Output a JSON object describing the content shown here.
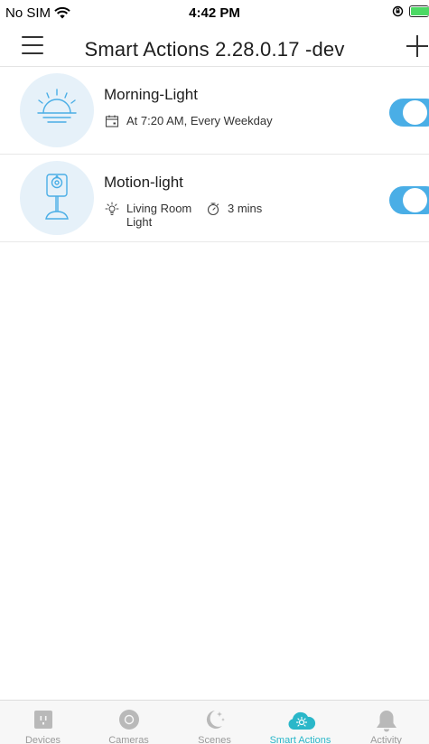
{
  "status_bar": {
    "carrier": "No SIM",
    "time": "4:42 PM"
  },
  "nav": {
    "title": "Smart Actions 2.28.0.17 -dev"
  },
  "actions": [
    {
      "name": "Morning-Light",
      "schedule": "At 7:20 AM, Every Weekday",
      "enabled": true
    },
    {
      "name": "Motion-light",
      "device": "Living Room Light",
      "duration": "3 mins",
      "enabled": true
    }
  ],
  "tabs": [
    {
      "label": "Devices",
      "icon": "outlet-icon"
    },
    {
      "label": "Cameras",
      "icon": "camera-icon"
    },
    {
      "label": "Scenes",
      "icon": "moon-icon"
    },
    {
      "label": "Smart Actions",
      "icon": "cloud-sun-icon",
      "active": true
    },
    {
      "label": "Activity",
      "icon": "bell-icon"
    }
  ],
  "colors": {
    "accent": "#2ab7c9",
    "toggle_on": "#4aaee6",
    "thumb_bg": "#e6f1f9",
    "inactive_tab": "#9a9a9a"
  }
}
